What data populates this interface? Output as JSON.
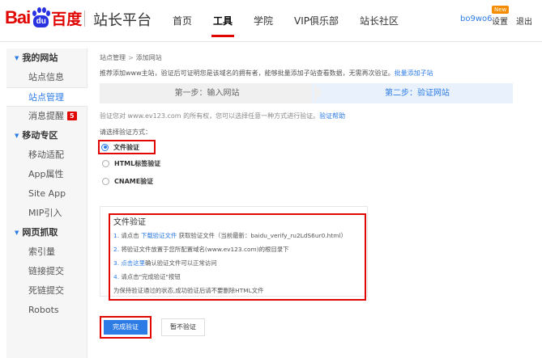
{
  "header": {
    "logo_left": "Bai",
    "logo_paw_text": "du",
    "logo_right": "百度",
    "site_title": "站长平台",
    "nav": [
      "首页",
      "工具",
      "学院",
      "VIP俱乐部",
      "站长社区"
    ],
    "active_nav_index": 1,
    "user_name": "bo9wo6",
    "new_badge": "New",
    "settings": "设置",
    "logout": "退出"
  },
  "sidebar": {
    "groups": [
      {
        "label": "我的网站",
        "items": [
          {
            "label": "站点信息"
          },
          {
            "label": "站点管理",
            "active": true
          },
          {
            "label": "消息提醒",
            "badge": "5"
          }
        ]
      },
      {
        "label": "移动专区",
        "items": [
          {
            "label": "移动适配"
          },
          {
            "label": "App属性"
          },
          {
            "label": "Site App"
          },
          {
            "label": "MIP引入"
          }
        ]
      },
      {
        "label": "网页抓取",
        "items": [
          {
            "label": "索引量"
          },
          {
            "label": "链接提交"
          },
          {
            "label": "死链提交"
          },
          {
            "label": "Robots"
          }
        ]
      }
    ]
  },
  "main": {
    "breadcrumb": [
      "站点管理",
      "添加网站"
    ],
    "breadcrumb_sep": ">",
    "intro": "推荐添加www主站，验证后可证明您是该域名的拥有者，能够批量添加子站查看数据，无需再次验证。",
    "intro_link": "批量添加子站",
    "step1": "第一步：输入网站",
    "step2": "第二步：验证网站",
    "verify_note": "验证您对 www.ev123.com 的所有权，您可以选择任意一种方式进行验证。",
    "verify_help": "验证帮助",
    "method_label": "请选择验证方式：",
    "methods": [
      {
        "label": "文件验证",
        "checked": true
      },
      {
        "label": "HTML标签验证",
        "checked": false
      },
      {
        "label": "CNAME验证",
        "checked": false
      }
    ],
    "file_box": {
      "title": "文件验证",
      "step1_num": "1. ",
      "step1_pre": "请点击 ",
      "step1_link": "下载验证文件",
      "step1_post": " 获取验证文件（当前最新：baidu_verify_ru2LdS6ur0.html）",
      "step2_num": "2. ",
      "step2": "将验证文件放置于您所配置域名(www.ev123.com)的根目录下",
      "step3_num": "3. ",
      "step3_link": "点击这里",
      "step3_post": "确认验证文件可以正常访问",
      "step4_num": "4. ",
      "step4": "请点击\"完成验证\"按钮",
      "note": "为保持验证通过的状态,成功验证后请不要删除HTML文件"
    },
    "finish_button": "完成验证",
    "skip_button": "暂不验证"
  },
  "colors": {
    "brand_red": "#e10602",
    "link_blue": "#2d7be5",
    "highlight_box": "#e10602"
  }
}
